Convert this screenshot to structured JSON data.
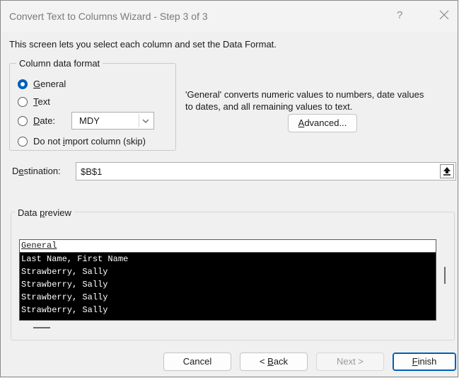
{
  "window": {
    "title": "Convert Text to Columns Wizard - Step 3 of 3",
    "help_glyph": "?"
  },
  "description": "This screen lets you select each column and set the Data Format.",
  "column_format": {
    "legend": "Column data format",
    "options": {
      "general": {
        "pre": "",
        "key": "G",
        "post": "eneral",
        "checked": true
      },
      "text": {
        "pre": "",
        "key": "T",
        "post": "ext",
        "checked": false
      },
      "date": {
        "pre": "",
        "key": "D",
        "post": "ate:",
        "checked": false
      },
      "skip": {
        "pre": "Do not ",
        "key": "i",
        "post": "mport column (skip)",
        "checked": false
      }
    },
    "date_format_value": "MDY",
    "info_line1": "'General' converts numeric values to numbers, date values",
    "info_line2": "to dates, and all remaining values to text.",
    "advanced": {
      "pre": "",
      "key": "A",
      "post": "dvanced..."
    }
  },
  "destination": {
    "label_pre": "D",
    "label_key": "e",
    "label_post": "stination:",
    "value": "$B$1",
    "button_glyph": "↑"
  },
  "preview": {
    "legend_pre": "Data ",
    "legend_key": "p",
    "legend_post": "review",
    "header": "General",
    "rows": [
      "Last Name, First Name",
      "Strawberry, Sally",
      "Strawberry, Sally",
      "Strawberry, Sally",
      "Strawberry, Sally"
    ]
  },
  "buttons": {
    "cancel": "Cancel",
    "back_pre": "< ",
    "back_key": "B",
    "back_post": "ack",
    "next": "Next >",
    "finish_key": "F",
    "finish_post": "inish"
  },
  "colors": {
    "accent": "#005fb8",
    "dialog_bg": "#f0f0f0",
    "preview_bg": "#000000"
  }
}
